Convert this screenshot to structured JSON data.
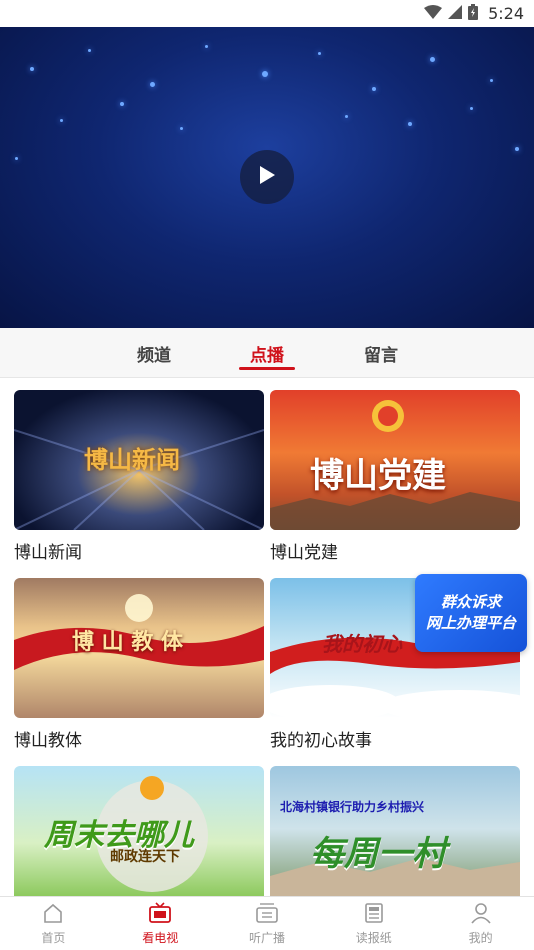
{
  "status_bar": {
    "time": "5:24",
    "icons": [
      "wifi-icon",
      "signal-icon",
      "battery-icon"
    ]
  },
  "video": {
    "play_icon": "play-icon"
  },
  "tabs": [
    {
      "label": "频道",
      "active": false
    },
    {
      "label": "点播",
      "active": true
    },
    {
      "label": "留言",
      "active": false
    }
  ],
  "programs": [
    {
      "title": "博山新闻",
      "thumb_text": "博山新闻"
    },
    {
      "title": "博山党建",
      "thumb_text": "博山党建"
    },
    {
      "title": "博山教体",
      "thumb_text": "博 山 教 体"
    },
    {
      "title": "我的初心故事",
      "thumb_text": "我的初心"
    },
    {
      "title": "",
      "thumb_text": "周末去哪儿",
      "thumb_subtext": "邮政连天下"
    },
    {
      "title": "",
      "thumb_text": "每周一村",
      "thumb_subtext": "北海村镇银行助力乡村振兴"
    }
  ],
  "float_banner": {
    "line1": "群众诉求",
    "line2": "网上办理平台"
  },
  "bottom_nav": [
    {
      "label": "首页",
      "icon": "home-icon",
      "active": false
    },
    {
      "label": "看电视",
      "icon": "tv-icon",
      "active": true
    },
    {
      "label": "听广播",
      "icon": "radio-icon",
      "active": false
    },
    {
      "label": "读报纸",
      "icon": "newspaper-icon",
      "active": false
    },
    {
      "label": "我的",
      "icon": "user-icon",
      "active": false
    }
  ],
  "colors": {
    "accent": "#d0121b",
    "video_bg": "#0f2670",
    "banner": "#1552d8"
  }
}
